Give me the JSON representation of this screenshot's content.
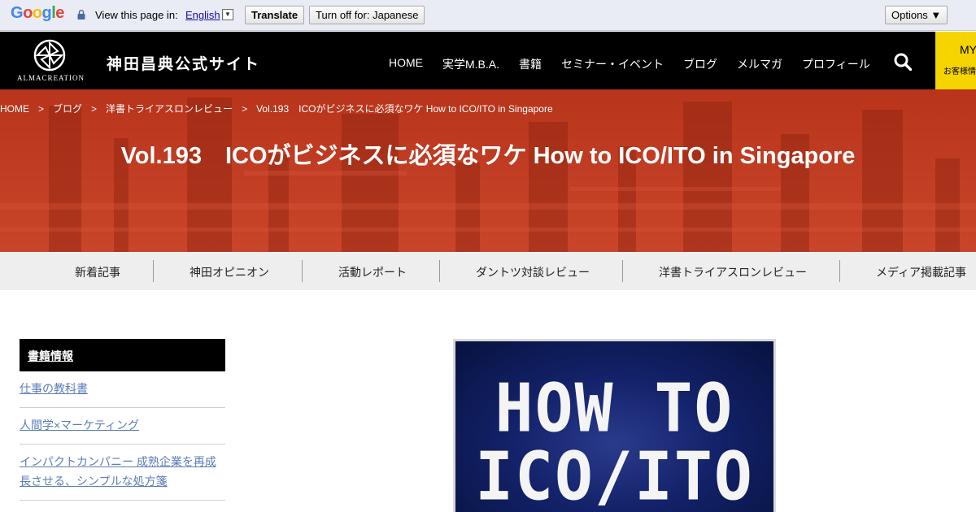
{
  "translate_bar": {
    "google_letters": [
      "G",
      "o",
      "o",
      "g",
      "l",
      "e"
    ],
    "google_colors": [
      "#4285f4",
      "#ea4335",
      "#fbbc05",
      "#4285f4",
      "#34a853",
      "#ea4335"
    ],
    "view_text": "View this page in:",
    "language": "English",
    "dropdown_glyph": "▼",
    "translate_label": "Translate",
    "turn_off_label": "Turn off for: Japanese",
    "options_label": "Options ▼",
    "icon": "lock-icon"
  },
  "header": {
    "logo_text": "ALMACREATION",
    "site_title": "神田昌典公式サイト",
    "nav": [
      "HOME",
      "実学M.B.A.",
      "書籍",
      "セミナー・イベント",
      "ブログ",
      "メルマガ",
      "プロフィール"
    ],
    "search_icon": "search-icon",
    "my_label": "MY",
    "my_sub": "お客様情報",
    "accent": "#f5d400"
  },
  "hero": {
    "breadcrumb": [
      "HOME",
      "ブログ",
      "洋書トライアスロンレビュー",
      "Vol.193　ICOがビジネスに必須なワケ How to ICO/ITO in Singapore"
    ],
    "breadcrumb_sep": ">",
    "title": "Vol.193　ICOがビジネスに必須なワケ How to ICO/ITO in Singapore",
    "color": "#c13a1f"
  },
  "categories": [
    "新着記事",
    "神田オピニオン",
    "活動レポート",
    "ダントツ対談レビュー",
    "洋書トライアスロンレビュー",
    "メディア掲載記事"
  ],
  "sidebar": {
    "heading": "書籍情報",
    "links": [
      {
        "lines": [
          "仕事の教科書"
        ]
      },
      {
        "lines": [
          "人間学×マーケティング"
        ]
      },
      {
        "lines": [
          "インパクトカンパニー 成熟企業を再成",
          "長させる、シンプルな処方箋"
        ]
      }
    ]
  },
  "book_cover": {
    "lines": [
      "HOW TO",
      "ICO/ITO"
    ]
  }
}
